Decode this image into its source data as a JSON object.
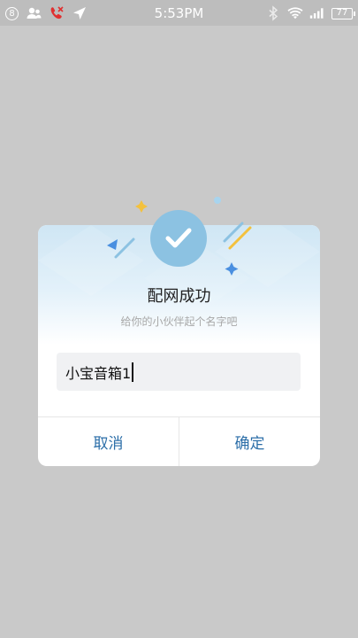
{
  "status_bar": {
    "notification_count": "8",
    "time": "5:53PM",
    "battery": "77",
    "icons": [
      "contact-icon",
      "missed-call-icon",
      "location-arrow-icon",
      "bluetooth-icon",
      "wifi-icon",
      "signal-icon",
      "battery-icon"
    ]
  },
  "dialog": {
    "title": "配网成功",
    "subtitle": "给你的小伙伴起个名字吧",
    "name_input_value": "小宝音箱1",
    "cancel_label": "取消",
    "confirm_label": "确定",
    "icon": "checkmark-icon"
  },
  "colors": {
    "overlay": "#c9c9c9",
    "accent": "#2b6ea8",
    "check_circle": "#8cc2e2",
    "header_gradient_top": "#cfe6f4"
  }
}
